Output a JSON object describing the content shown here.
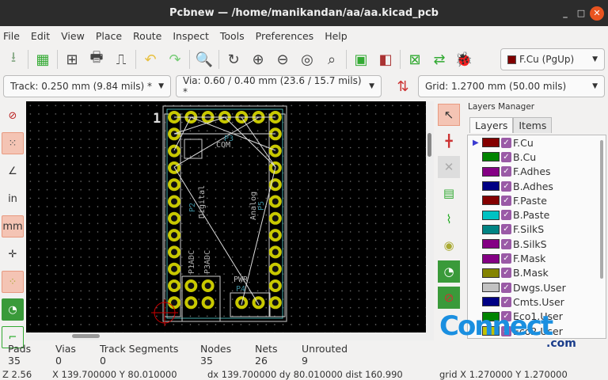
{
  "window": {
    "title": "Pcbnew — /home/manikandan/aa/aa.kicad_pcb",
    "minimize": "_",
    "maximize": "□",
    "close": "✕"
  },
  "menu": [
    "File",
    "Edit",
    "View",
    "Place",
    "Route",
    "Inspect",
    "Tools",
    "Preferences",
    "Help"
  ],
  "toolbar": {
    "icons": [
      "board-setup-icon",
      "pcb-settings-icon",
      "page-layout-icon",
      "print-icon",
      "plot-icon",
      "undo-icon",
      "redo-icon",
      "find-icon",
      "refresh-icon",
      "zoom-in-icon",
      "zoom-out-icon",
      "zoom-fit-icon",
      "zoom-selection-icon",
      "footprint-editor-icon",
      "footprint-viewer-icon",
      "netlist-icon",
      "update-pcb-icon",
      "drc-icon"
    ],
    "layer_select": "F.Cu (PgUp)",
    "layer_color": "#800000"
  },
  "toolbar2": {
    "track": "Track: 0.250 mm (9.84 mils) *",
    "via": "Via: 0.60 / 0.40 mm (23.6 / 15.7 mils) *",
    "grid": "Grid: 1.2700 mm (50.00 mils)"
  },
  "left_toolbar": {
    "in": "in",
    "mm": "mm"
  },
  "board": {
    "pin1": "1",
    "labels": {
      "com": "COM",
      "p2": "P2",
      "digital": "Digital",
      "analog": "Analog",
      "p5": "P5",
      "p1adc": "P1ADC",
      "p3adc": "P3ADC",
      "pwr": "PWR",
      "p4": "P4",
      "p3": "P3"
    }
  },
  "layers_panel": {
    "title": "Layers Manager",
    "tabs": [
      "Layers",
      "Items"
    ],
    "layers": [
      {
        "name": "F.Cu",
        "color": "#840000"
      },
      {
        "name": "B.Cu",
        "color": "#008400"
      },
      {
        "name": "F.Adhes",
        "color": "#840084"
      },
      {
        "name": "B.Adhes",
        "color": "#000084"
      },
      {
        "name": "F.Paste",
        "color": "#840000"
      },
      {
        "name": "B.Paste",
        "color": "#00c2c2"
      },
      {
        "name": "F.SilkS",
        "color": "#008484"
      },
      {
        "name": "B.SilkS",
        "color": "#840084"
      },
      {
        "name": "F.Mask",
        "color": "#840084"
      },
      {
        "name": "B.Mask",
        "color": "#848400"
      },
      {
        "name": "Dwgs.User",
        "color": "#c2c2c2"
      },
      {
        "name": "Cmts.User",
        "color": "#000084"
      },
      {
        "name": "Eco1.User",
        "color": "#008400"
      },
      {
        "name": "Eco2.User",
        "color": "#c2c200"
      }
    ]
  },
  "status": {
    "cols": [
      {
        "label": "Pads",
        "value": "35"
      },
      {
        "label": "Vias",
        "value": "0"
      },
      {
        "label": "Track Segments",
        "value": "0"
      },
      {
        "label": "Nodes",
        "value": "35"
      },
      {
        "label": "Nets",
        "value": "26"
      },
      {
        "label": "Unrouted",
        "value": "9"
      }
    ],
    "zoom": "Z 2.56",
    "xy": "X 139.700000  Y 80.010000",
    "delta": "dx 139.700000  dy 80.010000  dist 160.990",
    "grid": "grid X 1.270000  Y 1.270000"
  },
  "watermark": {
    "text": "Connect",
    "suffix": ".com"
  }
}
